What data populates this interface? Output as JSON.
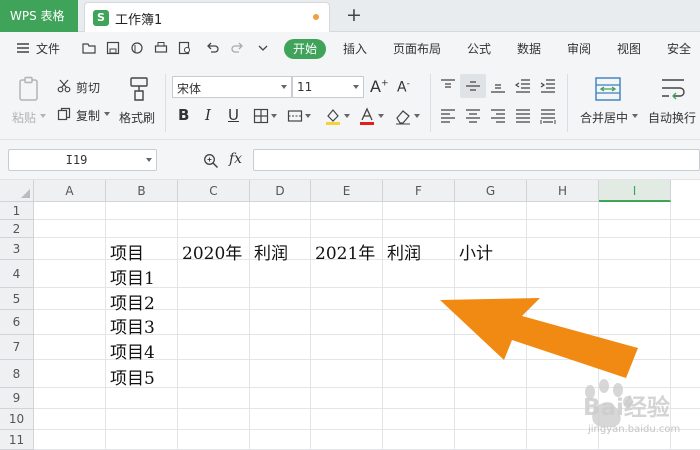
{
  "titlebar": {
    "app_tab": "WPS 表格",
    "doc_icon_letter": "S",
    "doc_title": "工作簿1",
    "new_tab": "+"
  },
  "menu": {
    "file": "文件",
    "tabs": [
      "开始",
      "插入",
      "页面布局",
      "公式",
      "数据",
      "审阅",
      "视图",
      "安全"
    ]
  },
  "ribbon": {
    "paste": "粘贴",
    "cut": "剪切",
    "copy": "复制",
    "format_painter": "格式刷",
    "font_name": "宋体",
    "font_size": "11",
    "bold": "B",
    "italic": "I",
    "underline": "U",
    "merge_center": "合并居中",
    "wrap_text": "自动换行"
  },
  "formula_bar": {
    "name_box": "I19",
    "fx": "fx",
    "content": ""
  },
  "grid": {
    "columns": [
      "A",
      "B",
      "C",
      "D",
      "E",
      "F",
      "G",
      "H",
      "I"
    ],
    "selected_column": "I",
    "rows": [
      "1",
      "2",
      "3",
      "4",
      "5",
      "6",
      "7",
      "8",
      "9",
      "10",
      "11"
    ],
    "cells": {
      "B3": "项目",
      "C3": "2020年",
      "D3": "利润",
      "E3": "2021年",
      "F3": "利润",
      "G3": "小计",
      "B4": "项目1",
      "B5": "项目2",
      "B6": "项目3",
      "B7": "项目4",
      "B8": "项目5"
    }
  },
  "watermark": {
    "text": "Bai经验",
    "sub": "jingyan.baidu.com"
  },
  "colors": {
    "accent": "#3fa35a",
    "arrow": "#f08a12"
  }
}
